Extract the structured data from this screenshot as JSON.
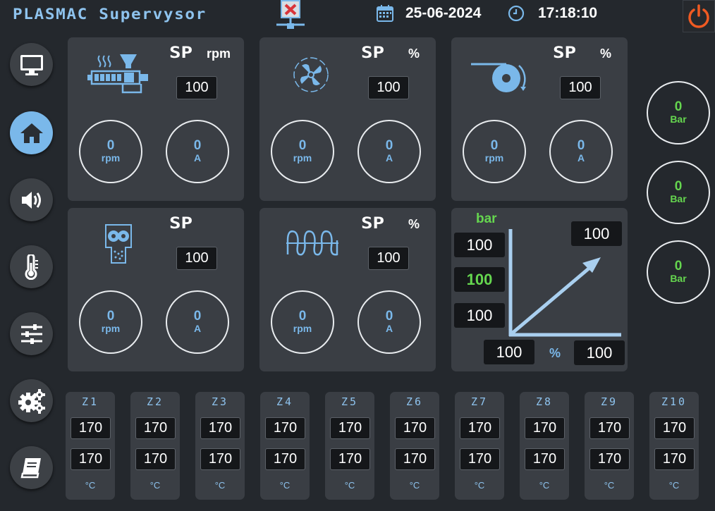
{
  "header": {
    "title": "PLASMAC Supervysor",
    "date": "25-06-2024",
    "time": "17:18:10"
  },
  "colors": {
    "accent": "#7ab8ea",
    "green": "#65d64f",
    "panel": "#3a3e44",
    "power": "#f05a22"
  },
  "sidebar": {
    "items": [
      {
        "name": "monitor-icon"
      },
      {
        "name": "home-icon",
        "active": true
      },
      {
        "name": "speaker-icon"
      },
      {
        "name": "thermometer-icon"
      },
      {
        "name": "sliders-icon"
      },
      {
        "name": "gears-icon"
      },
      {
        "name": "book-icon"
      }
    ]
  },
  "panels": {
    "extruder": {
      "sp": "SP",
      "unit": "rpm",
      "setpoint": "100",
      "speed": "0",
      "speed_unit": "rpm",
      "current": "0",
      "current_unit": "A",
      "icon": "extruder-icon"
    },
    "fan": {
      "sp": "SP",
      "unit": "%",
      "setpoint": "100",
      "speed": "0",
      "speed_unit": "rpm",
      "current": "0",
      "current_unit": "A",
      "icon": "fan-icon"
    },
    "winder": {
      "sp": "SP",
      "unit": "%",
      "setpoint": "100",
      "speed": "0",
      "speed_unit": "rpm",
      "current": "0",
      "current_unit": "A",
      "icon": "winder-icon"
    },
    "feeder": {
      "sp": "SP",
      "unit": "",
      "setpoint": "100",
      "speed": "0",
      "speed_unit": "rpm",
      "current": "0",
      "current_unit": "A",
      "icon": "feeder-icon"
    },
    "screw": {
      "sp": "SP",
      "unit": "%",
      "setpoint": "100",
      "speed": "0",
      "speed_unit": "rpm",
      "current": "0",
      "current_unit": "A",
      "icon": "screw-icon"
    }
  },
  "pressure": {
    "bar_label": "bar",
    "pct_label": "%",
    "y_top": "100",
    "y_mid": "100",
    "y_low": "100",
    "target": "100",
    "x_left": "100",
    "x_right": "100"
  },
  "bar_gauges": [
    {
      "value": "0",
      "unit": "Bar"
    },
    {
      "value": "0",
      "unit": "Bar"
    },
    {
      "value": "0",
      "unit": "Bar"
    }
  ],
  "zones": [
    {
      "label": "Z1",
      "set": "170",
      "actual": "170",
      "unit": "°C"
    },
    {
      "label": "Z2",
      "set": "170",
      "actual": "170",
      "unit": "°C"
    },
    {
      "label": "Z3",
      "set": "170",
      "actual": "170",
      "unit": "°C"
    },
    {
      "label": "Z4",
      "set": "170",
      "actual": "170",
      "unit": "°C"
    },
    {
      "label": "Z5",
      "set": "170",
      "actual": "170",
      "unit": "°C"
    },
    {
      "label": "Z6",
      "set": "170",
      "actual": "170",
      "unit": "°C"
    },
    {
      "label": "Z7",
      "set": "170",
      "actual": "170",
      "unit": "°C"
    },
    {
      "label": "Z8",
      "set": "170",
      "actual": "170",
      "unit": "°C"
    },
    {
      "label": "Z9",
      "set": "170",
      "actual": "170",
      "unit": "°C"
    },
    {
      "label": "Z10",
      "set": "170",
      "actual": "170",
      "unit": "°C"
    }
  ]
}
